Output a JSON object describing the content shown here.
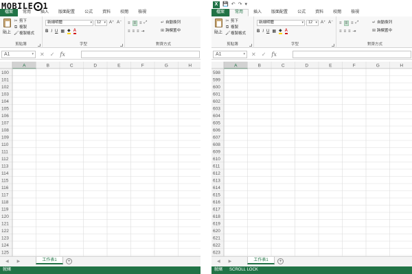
{
  "watermark": {
    "text": "MOBILE",
    "icon": "gear-icon"
  },
  "colors": {
    "accent": "#217346",
    "grid_line": "#dcdcdc",
    "header_bg": "#f3f3f3",
    "active_header": "#217346"
  },
  "ribbon": {
    "tabs": [
      "檔案",
      "常用",
      "插入",
      "版面配置",
      "公式",
      "資料",
      "校閱",
      "檢視"
    ],
    "active_tab": "常用",
    "clipboard": {
      "paste": "貼上",
      "cut": "剪下",
      "copy": "複製",
      "format_painter": "複製格式",
      "label": "剪貼簿"
    },
    "font": {
      "name": "新細明體",
      "size": "12",
      "label": "字型",
      "bold": "B",
      "italic": "I",
      "underline": "U",
      "font_color": "A"
    },
    "alignment": {
      "wrap": "自動換列",
      "merge": "跨欄置中",
      "label": "對齊方式"
    }
  },
  "formula_bar": {
    "cell": "A1",
    "fx": "fx",
    "cancel": "✕",
    "enter": "✓"
  },
  "columns": [
    "A",
    "B",
    "C",
    "D",
    "E",
    "F",
    "G",
    "H"
  ],
  "panes": [
    {
      "id": "left",
      "tabs_visible": [
        "檔案",
        "常用",
        "插入",
        "版面配置",
        "公式",
        "資料",
        "校閱",
        "檢視"
      ],
      "rows": [
        "100",
        "101",
        "102",
        "103",
        "104",
        "105",
        "106",
        "107",
        "108",
        "109",
        "110",
        "111",
        "112",
        "113",
        "114",
        "115",
        "116",
        "117",
        "118",
        "119",
        "120",
        "121",
        "122",
        "123",
        "124",
        "125"
      ],
      "sheet_tab": "工作表1",
      "status": "就緒",
      "status_extra": ""
    },
    {
      "id": "right",
      "tabs_visible": [
        "檔案",
        "常用",
        "插入",
        "版面配置",
        "公式",
        "資料",
        "校閱",
        "檢視"
      ],
      "rows": [
        "598",
        "599",
        "600",
        "601",
        "602",
        "603",
        "604",
        "605",
        "606",
        "607",
        "608",
        "609",
        "610",
        "611",
        "612",
        "613",
        "614",
        "615",
        "616",
        "617",
        "618",
        "619",
        "620",
        "621",
        "622",
        "623"
      ],
      "sheet_tab": "工作表1",
      "status": "就緒",
      "status_extra": "SCROLL LOCK"
    }
  ]
}
